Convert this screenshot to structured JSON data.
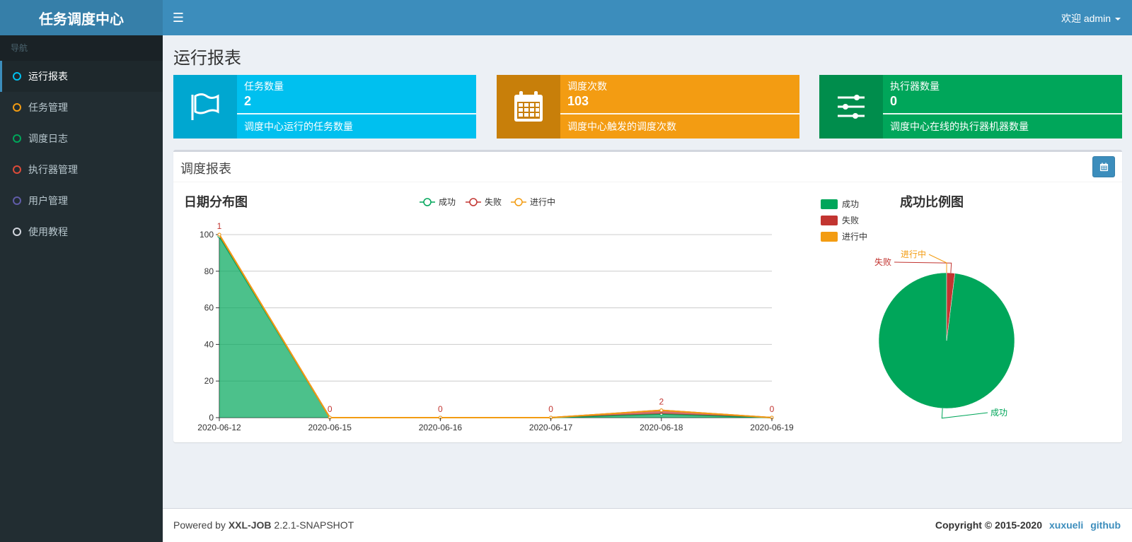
{
  "header": {
    "logo": "任务调度中心",
    "menu_icon": "hamburger-icon",
    "user": "欢迎 admin"
  },
  "sidebar": {
    "header": "导航",
    "items": [
      {
        "label": "运行报表",
        "color": "#00c0ef",
        "active": true
      },
      {
        "label": "任务管理",
        "color": "#f39c12"
      },
      {
        "label": "调度日志",
        "color": "#00a65a"
      },
      {
        "label": "执行器管理",
        "color": "#dd4b39"
      },
      {
        "label": "用户管理",
        "color": "#605ca8"
      },
      {
        "label": "使用教程",
        "color": "#d2d6de"
      }
    ]
  },
  "page": {
    "title": "运行报表"
  },
  "info_boxes": [
    {
      "label": "任务数量",
      "value": "2",
      "desc": "调度中心运行的任务数量",
      "icon": "flag-icon",
      "color": "#00c0ef",
      "icon_bg": "#00a7d0"
    },
    {
      "label": "调度次数",
      "value": "103",
      "desc": "调度中心触发的调度次数",
      "icon": "calendar-icon",
      "color": "#f39c12",
      "icon_bg": "#c87f0a"
    },
    {
      "label": "执行器数量",
      "value": "0",
      "desc": "调度中心在线的执行器机器数量",
      "icon": "sliders-icon",
      "color": "#00a65a",
      "icon_bg": "#008d4c"
    }
  ],
  "report": {
    "title": "调度报表",
    "button_icon": "calendar-icon"
  },
  "chart_data": [
    {
      "type": "area",
      "title": "日期分布图",
      "x": [
        "2020-06-12",
        "2020-06-15",
        "2020-06-16",
        "2020-06-17",
        "2020-06-18",
        "2020-06-19"
      ],
      "yticks": [
        "0",
        "20",
        "40",
        "60",
        "80",
        "100"
      ],
      "ylim": [
        0,
        100
      ],
      "legend": [
        "成功",
        "失败",
        "进行中"
      ],
      "legend_position": "top",
      "series": [
        {
          "name": "成功",
          "color": "#00a65a",
          "values": [
            99,
            0,
            0,
            0,
            2,
            0
          ]
        },
        {
          "name": "失败",
          "color": "#c23531",
          "values": [
            1,
            0,
            0,
            0,
            2,
            0
          ]
        },
        {
          "name": "进行中",
          "color": "#f39c12",
          "values": [
            0,
            0,
            0,
            0,
            0,
            0
          ]
        }
      ],
      "data_labels": [
        "1",
        "0",
        "0",
        "0",
        "2",
        "0"
      ]
    },
    {
      "type": "pie",
      "title": "成功比例图",
      "legend": [
        "成功",
        "失败",
        "进行中"
      ],
      "legend_position": "top-left",
      "slices": [
        {
          "name": "成功",
          "value": 101,
          "color": "#00a65a"
        },
        {
          "name": "失败",
          "value": 2,
          "color": "#c23531"
        },
        {
          "name": "进行中",
          "value": 0,
          "color": "#f39c12"
        }
      ]
    }
  ],
  "footer": {
    "powered_prefix": "Powered by ",
    "product": "XXL-JOB",
    "version": " 2.2.1-SNAPSHOT",
    "copyright": "Copyright © 2015-2020",
    "link1": "xuxueli",
    "link2": "github"
  }
}
